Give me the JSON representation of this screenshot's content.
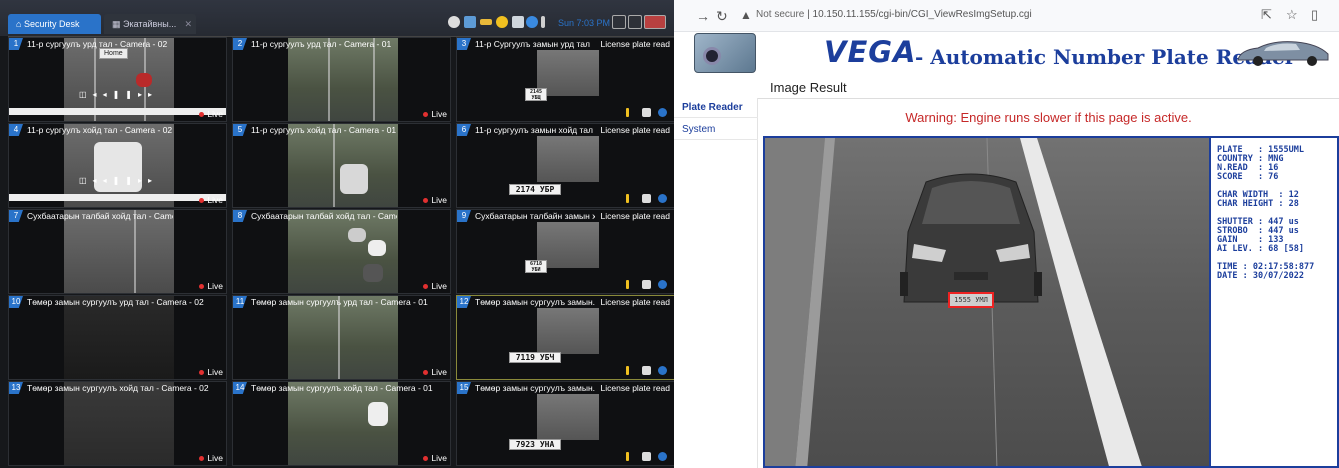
{
  "left_app": {
    "tabs": [
      {
        "label": "Security Desk"
      },
      {
        "label": "Экатайвны..."
      }
    ],
    "clock": "Sun 7:03 PM",
    "tooltip": "Home",
    "live_label": "Live",
    "lpr_label": "License plate read",
    "tiles": [
      {
        "num": "1",
        "title": "11-р сургуулъ урд тал - Camera - 02"
      },
      {
        "num": "2",
        "title": "11-р сургуулъ урд тал - Camera - 01"
      },
      {
        "num": "3",
        "title": "11-р Сургуулъ замын урд тал"
      },
      {
        "num": "4",
        "title": "11-р сургуулъ хойд тал - Camera - 02"
      },
      {
        "num": "5",
        "title": "11-р сургуулъ хойд тал - Camera - 01"
      },
      {
        "num": "6",
        "title": "11-р сургуулъ замын хойд тал"
      },
      {
        "num": "7",
        "title": "Сухбаатарын талбай хойд тал - Camera - 02"
      },
      {
        "num": "8",
        "title": "Сухбаатарын талбай хойд тал - Camera - 01"
      },
      {
        "num": "9",
        "title": "Сухбаатарын талбайн замын хо..."
      },
      {
        "num": "10",
        "title": "Төмөр замын сургуулъ урд тал - Camera - 02"
      },
      {
        "num": "11",
        "title": "Төмөр замын сургуулъ урд тал - Camera - 01"
      },
      {
        "num": "12",
        "title": "Төмөр замын сургуулъ замын..."
      },
      {
        "num": "13",
        "title": "Төмөр замын сургуулъ хойд тал - Camera - 02"
      },
      {
        "num": "14",
        "title": "Төмөр замын сургуулъ хойд тал - Camera - 01"
      },
      {
        "num": "15",
        "title": "Төмөр замын сургуулъ замын..."
      }
    ],
    "plates": [
      "2145 УБЩ",
      "2174 УБР",
      "6718 УБИ",
      "7119 УБЧ",
      "7923 УНА"
    ]
  },
  "browser": {
    "url_prefix": "Not secure",
    "url": "10.150.11.155/cgi-bin/CGI_ViewResImgSetup.cgi",
    "brand": "VEGA",
    "banner_title": "- Automatic Number Plate Reader",
    "page_title": "Image Result",
    "warning": "Warning: Engine runs slower if this page is active.",
    "nav": [
      {
        "label": "Plate Reader"
      },
      {
        "label": "System"
      }
    ],
    "result": {
      "lines": [
        "PLATE   : 1555UML",
        "COUNTRY : MNG",
        "N.READ  : 16",
        "SCORE   : 76",
        "",
        "CHAR WIDTH  : 12",
        "CHAR HEIGHT : 28",
        "",
        "SHUTTER : 447 us",
        "STROBO  : 447 us",
        "GAIN    : 133",
        "AI LEV. : 68 [58]",
        "",
        "TIME : 02:17:58:877",
        "DATE : 30/07/2022"
      ],
      "plate_in_image": "1555 УМЛ"
    }
  },
  "colors": {
    "accent": "#2a73c9",
    "vega_blue": "#1c3e9c",
    "warning_red": "#c62828"
  }
}
